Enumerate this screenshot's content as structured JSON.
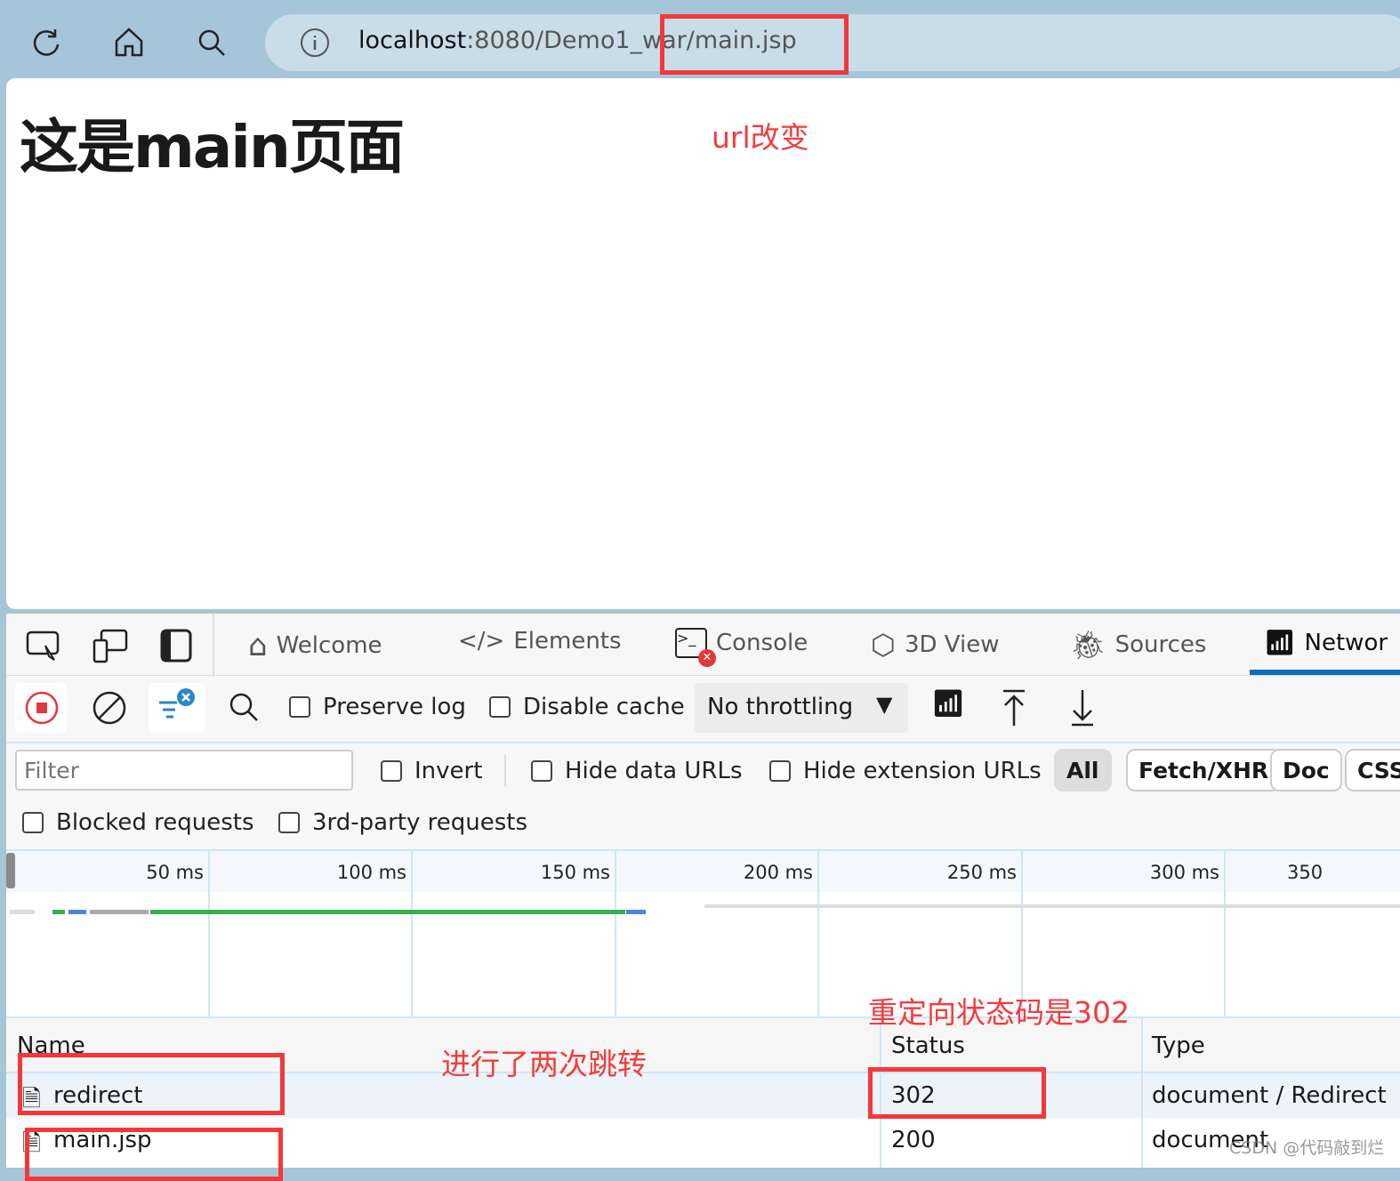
{
  "browser": {
    "url_host": "localhost",
    "url_rest": ":8080/Demo1_war/main.jsp",
    "icons": [
      "refresh-icon",
      "home-icon",
      "search-icon",
      "info-icon"
    ]
  },
  "page": {
    "heading": "这是main页面"
  },
  "annotations": {
    "url_changed": "url改变",
    "two_redirects": "进行了两次跳转",
    "status_302": "重定向状态码是302"
  },
  "devtools": {
    "tabs": [
      {
        "label": "Welcome"
      },
      {
        "label": "Elements"
      },
      {
        "label": "Console"
      },
      {
        "label": "3D View"
      },
      {
        "label": "Sources"
      },
      {
        "label": "Networ"
      }
    ],
    "toolbar": {
      "preserve_log": "Preserve log",
      "disable_cache": "Disable cache",
      "throttling": "No throttling"
    },
    "filter": {
      "placeholder": "Filter",
      "invert": "Invert",
      "hide_data_urls": "Hide data URLs",
      "hide_extension_urls": "Hide extension URLs",
      "chips": [
        "All",
        "Fetch/XHR",
        "Doc",
        "CSS"
      ],
      "blocked": "Blocked requests",
      "third_party": "3rd-party requests"
    },
    "timeline": {
      "ticks": [
        "50 ms",
        "100 ms",
        "150 ms",
        "200 ms",
        "250 ms",
        "300 ms",
        "350"
      ]
    },
    "table": {
      "columns": [
        "Name",
        "Status",
        "Type"
      ],
      "rows": [
        {
          "name": "redirect",
          "status": "302",
          "type": "document / Redirect"
        },
        {
          "name": "main.jsp",
          "status": "200",
          "type": "document"
        }
      ]
    }
  },
  "watermark": "CSDN @代码敲到烂",
  "colors": {
    "accent": "#0f6cbd",
    "annotation": "#f53b3b",
    "record": "#e03a3a"
  }
}
